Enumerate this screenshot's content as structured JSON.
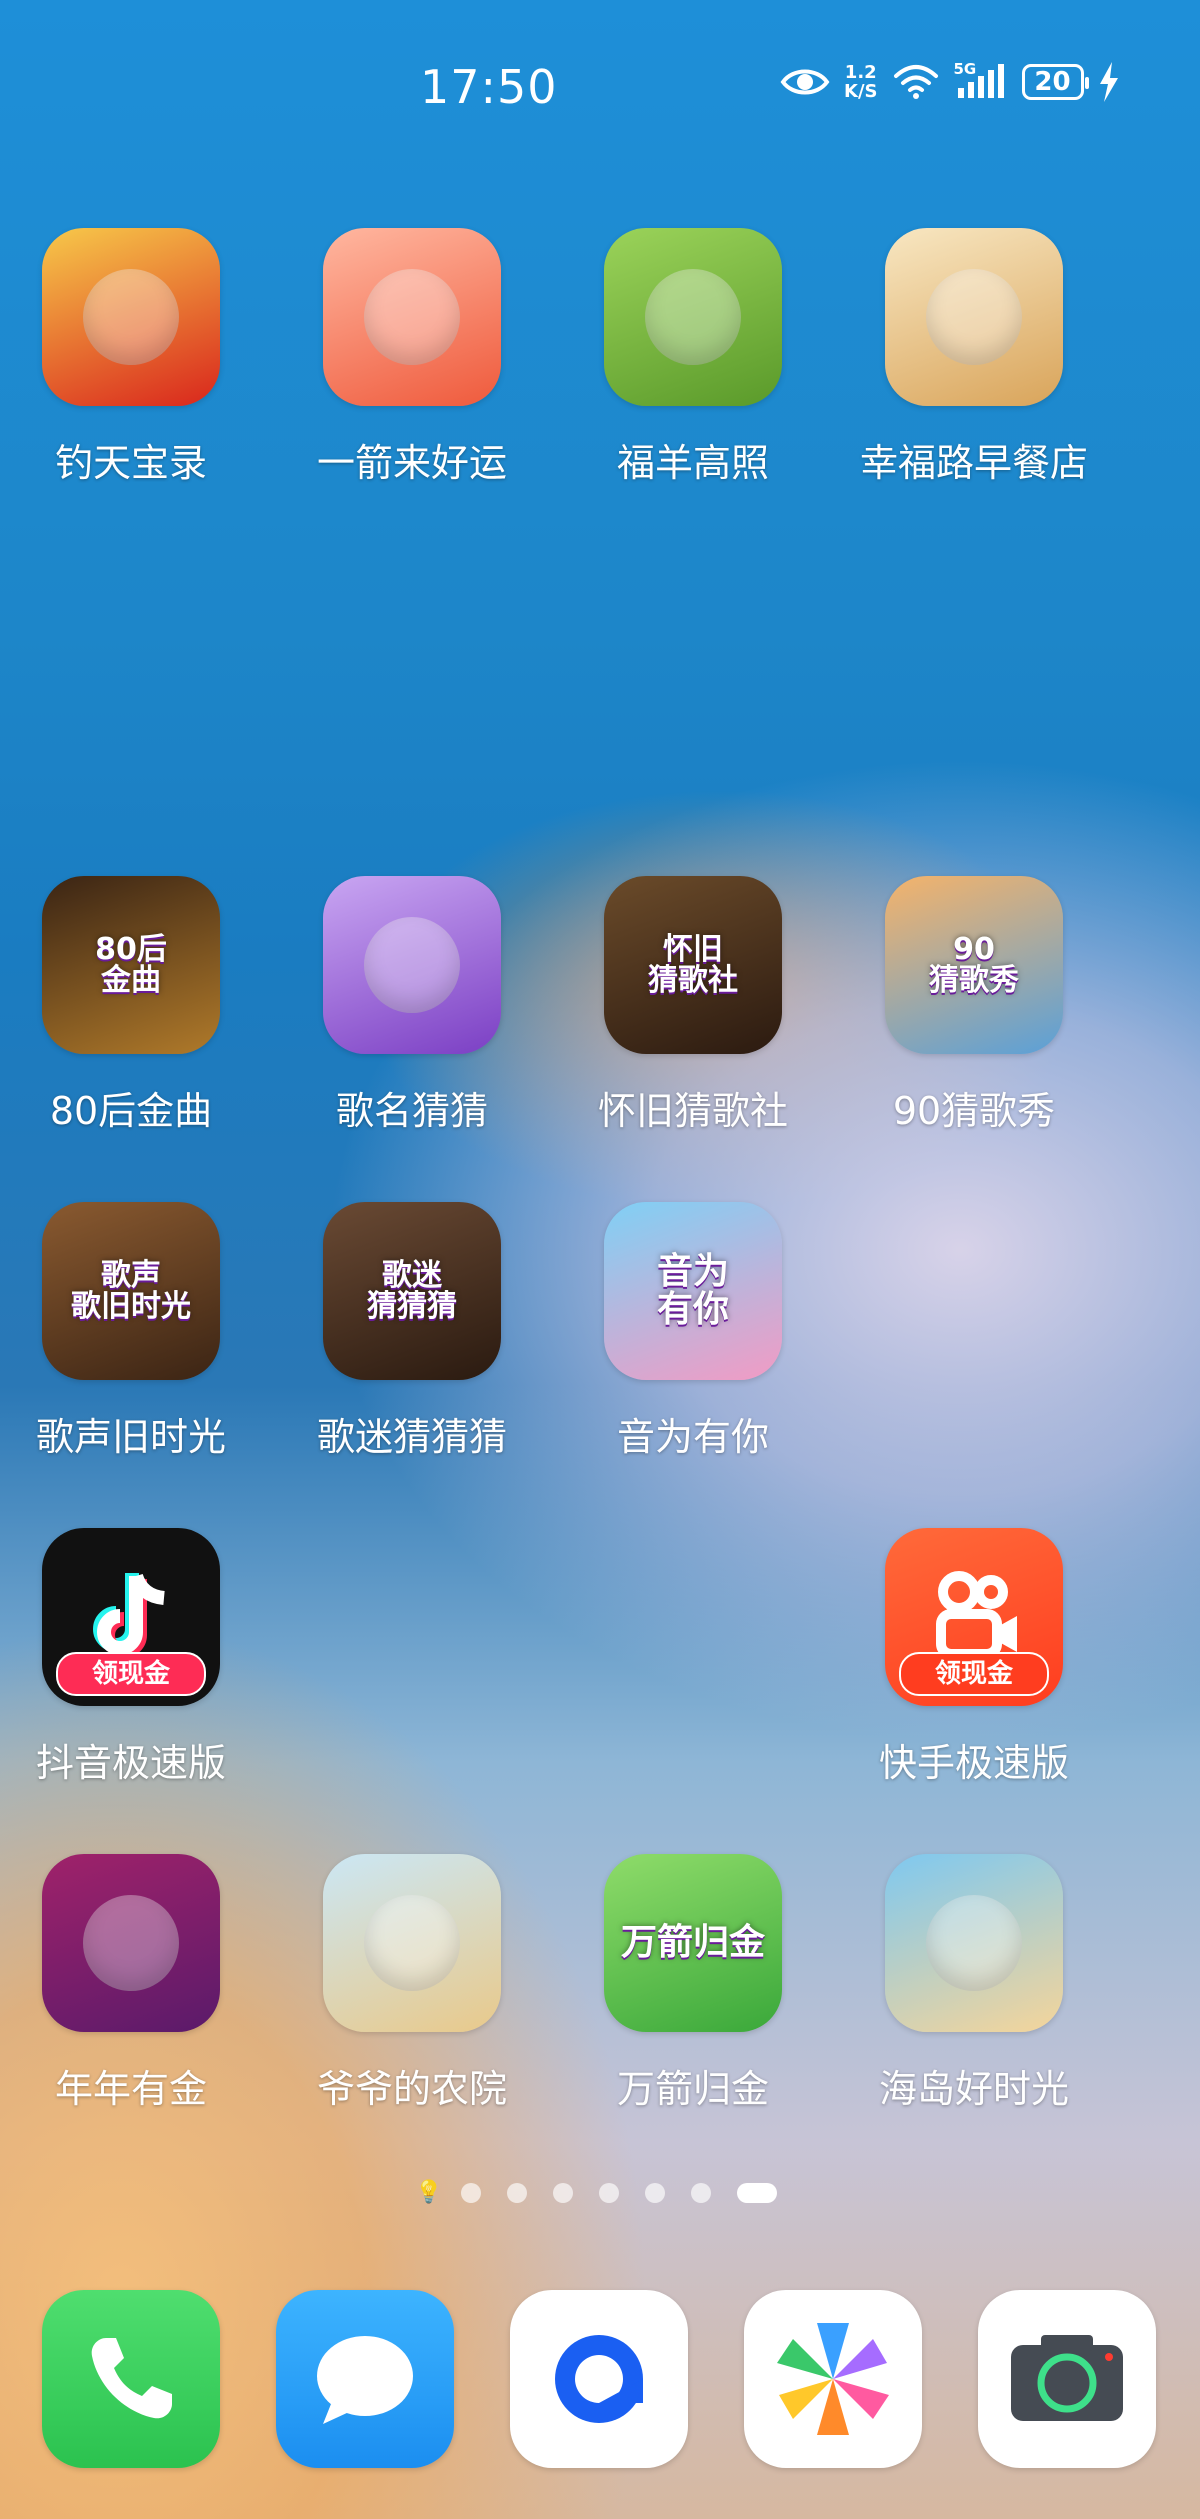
{
  "status_bar": {
    "time": "17:50",
    "net_speed_value": "1.2",
    "net_speed_unit": "K/S",
    "signal_label": "5G",
    "battery_level": "20",
    "charging": true
  },
  "apps": [
    {
      "label": "钓天宝录",
      "icon": "fortune-god-icon",
      "art": "",
      "colors": [
        "#f7c94a",
        "#d9261c"
      ]
    },
    {
      "label": "一箭来好运",
      "icon": "red-arrow-icon",
      "art": "",
      "colors": [
        "#ffb7a0",
        "#ef5a3c"
      ]
    },
    {
      "label": "福羊高照",
      "icon": "sheep-icon",
      "art": "",
      "colors": [
        "#9bd35a",
        "#5a9a2a"
      ]
    },
    {
      "label": "幸福路早餐店",
      "icon": "breakfast-icon",
      "art": "",
      "colors": [
        "#f8e7c2",
        "#d9a45a"
      ]
    },
    {
      "label": "80后金曲",
      "icon": "music-80s-icon",
      "art": "80后\n金曲",
      "colors": [
        "#3a2414",
        "#b07a2a"
      ]
    },
    {
      "label": "歌名猜猜",
      "icon": "dj-girl-icon",
      "art": "",
      "colors": [
        "#c9a6f2",
        "#7b3fc4"
      ]
    },
    {
      "label": "怀旧猜歌社",
      "icon": "retro-car-icon",
      "art": "怀旧\n猜歌社",
      "colors": [
        "#6b4b2a",
        "#2b1a10"
      ]
    },
    {
      "label": "90猜歌秀",
      "icon": "sunset-music-icon",
      "art": "90\n猜歌秀",
      "colors": [
        "#f5b36a",
        "#5aa0d8"
      ]
    },
    {
      "label": "歌声旧时光",
      "icon": "old-street-icon",
      "art": "歌声\n歌旧时光",
      "colors": [
        "#8a5a30",
        "#3b2414"
      ]
    },
    {
      "label": "歌迷猜猜猜",
      "icon": "cafe-icon",
      "art": "歌迷\n猜猜猜",
      "colors": [
        "#6a4a34",
        "#2a1a10"
      ]
    },
    {
      "label": "音为有你",
      "icon": "water-park-icon",
      "art": "音为\n有你",
      "colors": [
        "#7fd0f5",
        "#f29bc4"
      ]
    },
    {
      "label": "抖音极速版",
      "icon": "douyin-icon",
      "art": "",
      "badge": "领现金",
      "colors": [
        "#111111",
        "#111111"
      ]
    },
    {
      "label": "快手极速版",
      "icon": "kuaishou-icon",
      "art": "",
      "badge": "领现金",
      "colors": [
        "#ff6a3a",
        "#ff3d1f"
      ]
    },
    {
      "label": "年年有金",
      "icon": "treasure-chest-icon",
      "art": "",
      "colors": [
        "#a0226a",
        "#5a1a6a"
      ]
    },
    {
      "label": "爷爷的农院",
      "icon": "grandpa-farm-icon",
      "art": "",
      "colors": [
        "#cbe7f5",
        "#e9c98a"
      ]
    },
    {
      "label": "万箭归金",
      "icon": "arrow-coin-icon",
      "art": "万箭归金",
      "colors": [
        "#8fdc6a",
        "#3aa83a"
      ]
    },
    {
      "label": "海岛好时光",
      "icon": "island-girl-icon",
      "art": "",
      "colors": [
        "#7ec8f0",
        "#f5d59a"
      ]
    }
  ],
  "page_indicator": {
    "total_dots": 7,
    "active_index": 7
  },
  "dock": [
    {
      "name": "phone",
      "icon": "phone-icon"
    },
    {
      "name": "messages",
      "icon": "message-bubble-icon"
    },
    {
      "name": "browser",
      "icon": "browser-icon"
    },
    {
      "name": "gallery",
      "icon": "pinwheel-icon"
    },
    {
      "name": "camera",
      "icon": "camera-icon"
    }
  ]
}
